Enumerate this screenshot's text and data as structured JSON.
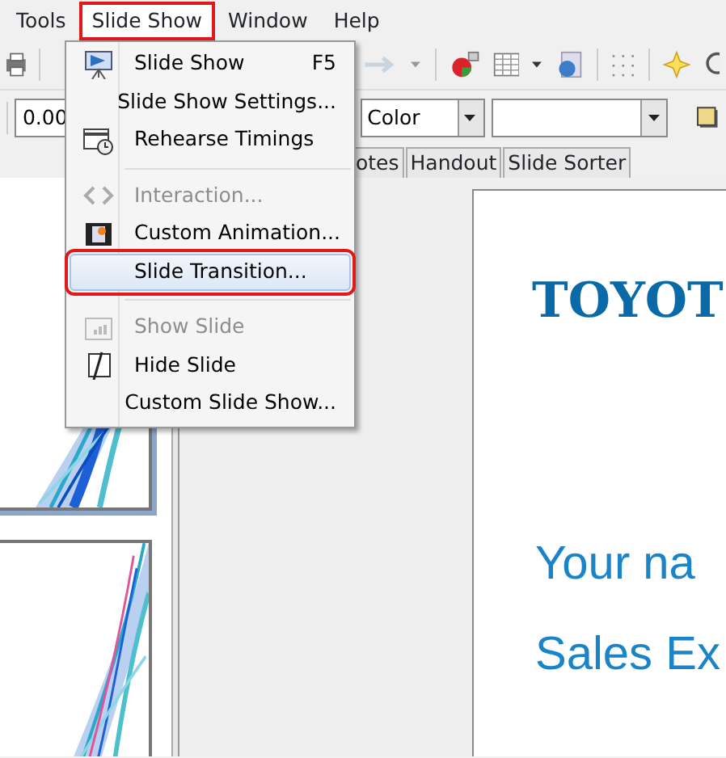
{
  "menubar": [
    {
      "label": "Tools",
      "selected": false,
      "annotated": false
    },
    {
      "label": "Slide Show",
      "selected": true,
      "annotated": true
    },
    {
      "label": "Window",
      "selected": false,
      "annotated": false
    },
    {
      "label": "Help",
      "selected": false,
      "annotated": false
    }
  ],
  "toolbar_fields": [
    {
      "kind": "text",
      "value": "0.00"
    },
    {
      "kind": "combo",
      "value": "Color"
    },
    {
      "kind": "combo"
    }
  ],
  "view_tabs": [
    {
      "label": "otes",
      "selected": false
    },
    {
      "label": "Handout",
      "selected": false
    },
    {
      "label": "Slide Sorter",
      "selected": false
    }
  ],
  "menu": [
    {
      "kind": "item",
      "label": "Slide Show",
      "shortcut": "F5",
      "disabled": false,
      "selected": false,
      "annotated": false
    },
    {
      "kind": "item",
      "label": "Slide Show Settings...",
      "disabled": false,
      "selected": false,
      "annotated": false
    },
    {
      "kind": "item",
      "label": "Rehearse Timings",
      "disabled": false,
      "selected": false,
      "annotated": false
    },
    {
      "kind": "separator"
    },
    {
      "kind": "item",
      "label": "Interaction...",
      "disabled": true,
      "selected": false,
      "annotated": false
    },
    {
      "kind": "item",
      "label": "Custom Animation...",
      "disabled": false,
      "selected": false,
      "annotated": false
    },
    {
      "kind": "item",
      "label": "Slide Transition...",
      "disabled": false,
      "selected": true,
      "annotated": true
    },
    {
      "kind": "separator"
    },
    {
      "kind": "item",
      "label": "Show Slide",
      "disabled": true,
      "selected": false,
      "annotated": false
    },
    {
      "kind": "item",
      "label": "Hide Slide",
      "disabled": false,
      "selected": false,
      "annotated": false
    },
    {
      "kind": "item",
      "label": "Custom Slide Show...",
      "disabled": false,
      "selected": false,
      "annotated": false
    }
  ],
  "slide": {
    "title": "TOYOT",
    "lines": [
      "Your na",
      "Sales Ex"
    ]
  }
}
